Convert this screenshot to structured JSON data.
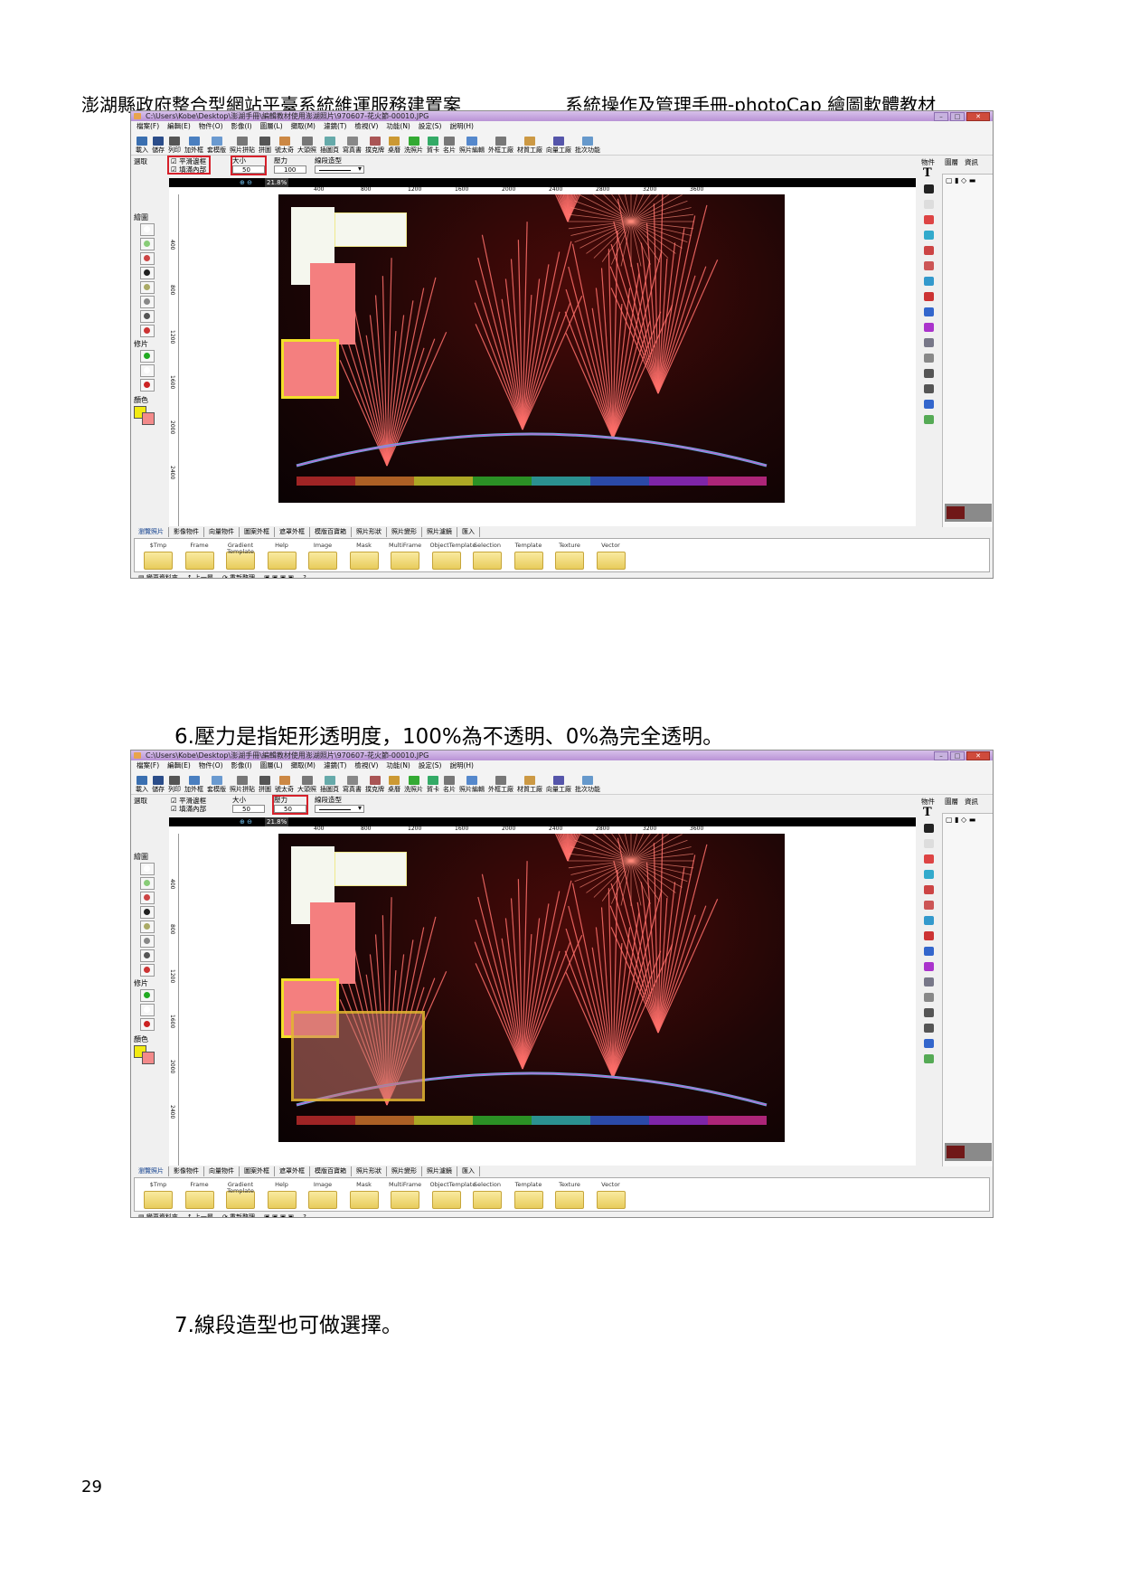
{
  "header": {
    "left": "澎湖縣政府整合型網站平臺系統維運服務建置案",
    "right": "系統操作及管理手冊-photoCap 繪圖軟體教材"
  },
  "steps": {
    "step6": "6.壓力是指矩形透明度，100%為不透明、0%為完全透明。",
    "step7": "7.線段造型也可做選擇。"
  },
  "page_number": "29",
  "screenshot": {
    "title": "C:\\Users\\Kobe\\Desktop\\澎湖手冊\\編輯教材使用澎湖照片\\970607-花火節-00010.JPG",
    "menu": [
      "檔案(F)",
      "編輯(E)",
      "物件(O)",
      "影像(I)",
      "圖層(L)",
      "擷取(M)",
      "濾鏡(T)",
      "檢視(V)",
      "功能(N)",
      "設定(S)",
      "說明(H)"
    ],
    "toolbar": [
      "載入",
      "儲存",
      "列印",
      "加外框",
      "套模版",
      "照片拼貼",
      "拼圖",
      "號太奇",
      "大頭照",
      "插圖頁",
      "寫真書",
      "撲克牌",
      "桌曆",
      "洗照片",
      "賀卡",
      "名片",
      "照片編輯",
      "外框工廠",
      "材質工廠",
      "向量工廠",
      "批次功能"
    ],
    "options": {
      "smooth": "平滑邊框",
      "fill": "填滿內部",
      "size_label": "大小",
      "size_value": "50",
      "pressure_label": "壓力",
      "pressure_value_a": "100",
      "pressure_value_b": "50",
      "line_label": "線段造型"
    },
    "zoom": "21.8%",
    "ruler_ticks": [
      "400",
      "800",
      "1200",
      "1600",
      "2000",
      "2400",
      "2800",
      "3200",
      "3600"
    ],
    "left_ruler_ticks": [
      "400",
      "800",
      "1200",
      "1600",
      "2000",
      "2400"
    ],
    "left_sections": [
      "選取",
      "繪圖",
      "修片",
      "顏色"
    ],
    "right_tabs": [
      "物件",
      "圖層",
      "資訊"
    ],
    "bottom_tabs": [
      "瀏覽照片",
      "影像物件",
      "向量物件",
      "圖案外框",
      "遮罩外框",
      "模版百寶箱",
      "照片形狀",
      "照片變形",
      "照片濾鏡",
      "匯入"
    ],
    "folders": [
      "$Tmp",
      "Frame",
      "Gradient Template",
      "Help",
      "Image",
      "Mask",
      "MultiFrame",
      "ObjectTemplate",
      "Selection",
      "Template",
      "Texture",
      "Vector"
    ],
    "status": [
      "變更資料夾",
      "上一層",
      "重新整理",
      "?"
    ]
  },
  "colors": {
    "highlight_red": "#d6202a",
    "rect_salmon": "#f47f7f",
    "rect_yellow_border": "#f2e02a",
    "rect_white": "#f5f7ee",
    "translucent_rect": "#a06058"
  }
}
